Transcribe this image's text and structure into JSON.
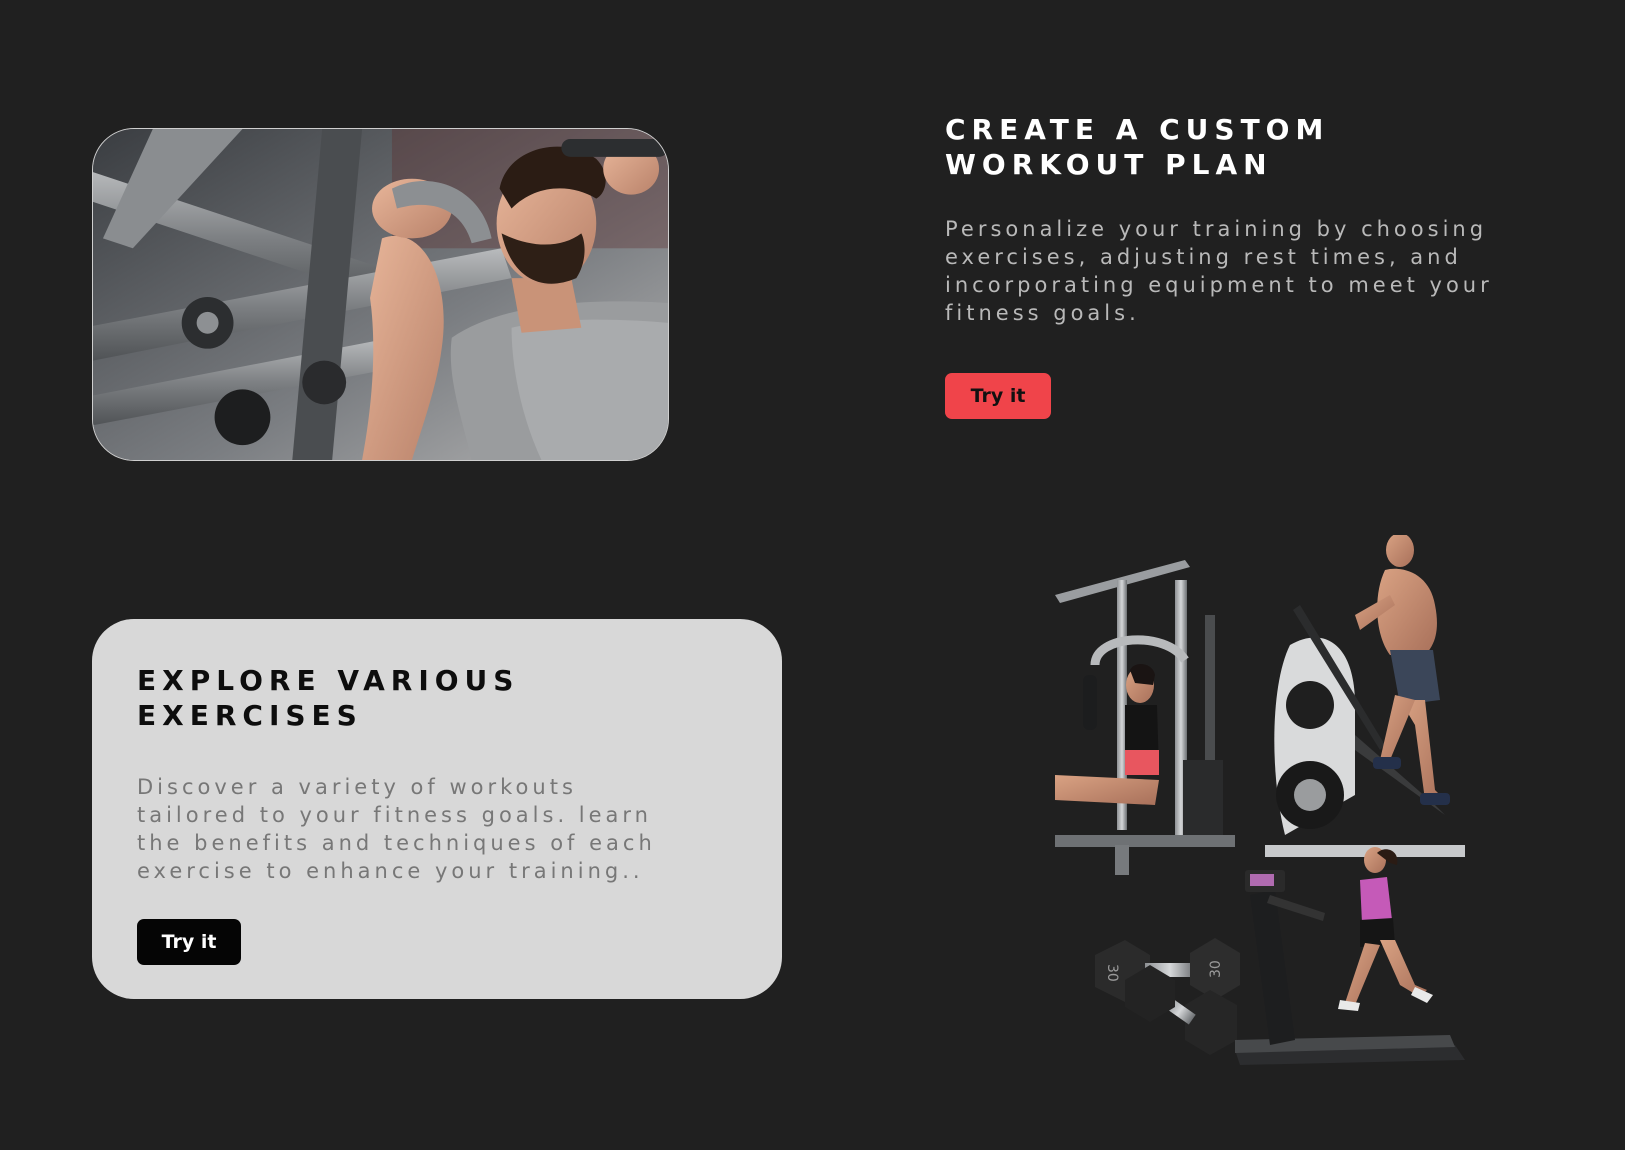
{
  "custom_plan": {
    "title_lines": [
      "CREATE A CUSTOM",
      "WORKOUT PLAN"
    ],
    "description_lines": [
      "Personalize your training by choosing",
      "exercises, adjusting rest times, and",
      "incorporating equipment to meet your",
      "fitness goals."
    ],
    "button_label": "Try it",
    "button_color": "#f0444a"
  },
  "explore": {
    "title_lines": [
      "EXPLORE VARIOUS",
      "EXERCISES"
    ],
    "description_lines": [
      "Discover a variety of workouts",
      "tailored to your fitness goals. learn",
      "the benefits and techniques of each",
      "exercise to enhance your training.."
    ],
    "button_label": "Try it",
    "card_color": "#d8d8d8"
  },
  "images": {
    "hero": "man-using-shoulder-press-machine-photo",
    "collage": "home-gym-elliptical-dumbbells-treadmill-collage",
    "dumbbell_labels": [
      "30",
      "30"
    ]
  },
  "colors": {
    "background": "#202020",
    "accent": "#f0444a"
  }
}
